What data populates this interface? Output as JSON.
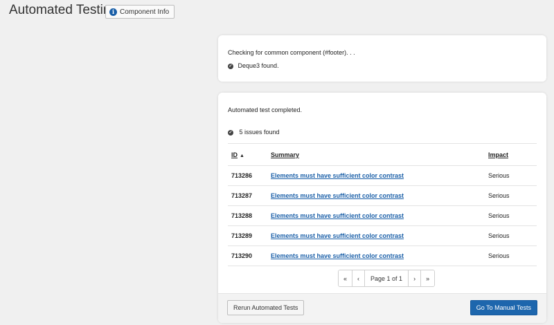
{
  "page": {
    "title": "Automated Testing",
    "component_info_label": "Component Info"
  },
  "component_check": {
    "message": "Checking for common component (#footer). . .",
    "result": "Deque3 found."
  },
  "results": {
    "message": "Automated test completed.",
    "issues_count": "5 issues found",
    "columns": {
      "id": "ID",
      "sort_indicator": "▲",
      "summary": "Summary",
      "impact": "Impact"
    },
    "rows": [
      {
        "id": "713286",
        "summary": "Elements must have sufficient color contrast",
        "impact": "Serious"
      },
      {
        "id": "713287",
        "summary": "Elements must have sufficient color contrast",
        "impact": "Serious"
      },
      {
        "id": "713288",
        "summary": "Elements must have sufficient color contrast",
        "impact": "Serious"
      },
      {
        "id": "713289",
        "summary": "Elements must have sufficient color contrast",
        "impact": "Serious"
      },
      {
        "id": "713290",
        "summary": "Elements must have sufficient color contrast",
        "impact": "Serious"
      }
    ]
  },
  "pagination": {
    "first": "«",
    "prev": "‹",
    "page_label": "Page 1 of 1",
    "next": "›",
    "last": "»"
  },
  "actions": {
    "rerun_label": "Rerun Automated Tests",
    "manual_label": "Go To Manual Tests"
  },
  "colors": {
    "accent": "#1d66ad",
    "link": "#1a5fa8",
    "background": "#f0f0f0"
  },
  "icons": {
    "info": "info-icon",
    "check": "check-circle-icon"
  }
}
